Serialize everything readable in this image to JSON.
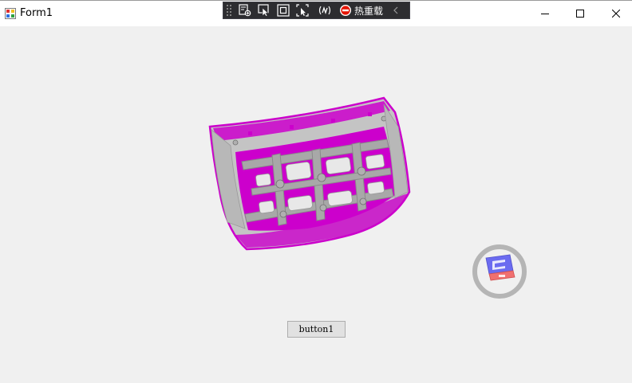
{
  "window": {
    "title": "Form1",
    "icon": "winforms-app-icon",
    "controls": [
      "minimize-icon",
      "maximize-icon",
      "close-icon"
    ]
  },
  "debug_toolbar": {
    "icons": [
      "live-visual-tree-icon",
      "select-element-icon",
      "display-layout-adorners-icon",
      "track-focus-icon",
      "binding-failures-icon"
    ],
    "hot_reload_label": "热重载",
    "hot_reload_icon": "stop-icon",
    "collapse_icon": "chevron-left-icon"
  },
  "viewport": {
    "model_colors": {
      "surface": "#c2c2c2",
      "highlight": "#cc00cc",
      "edge": "#9a009a"
    },
    "nav_cube": {
      "top_face": "#6b6bf0",
      "front_face": "#f07070",
      "ring": "#b5b5b5"
    }
  },
  "button1": {
    "label": "button1"
  }
}
